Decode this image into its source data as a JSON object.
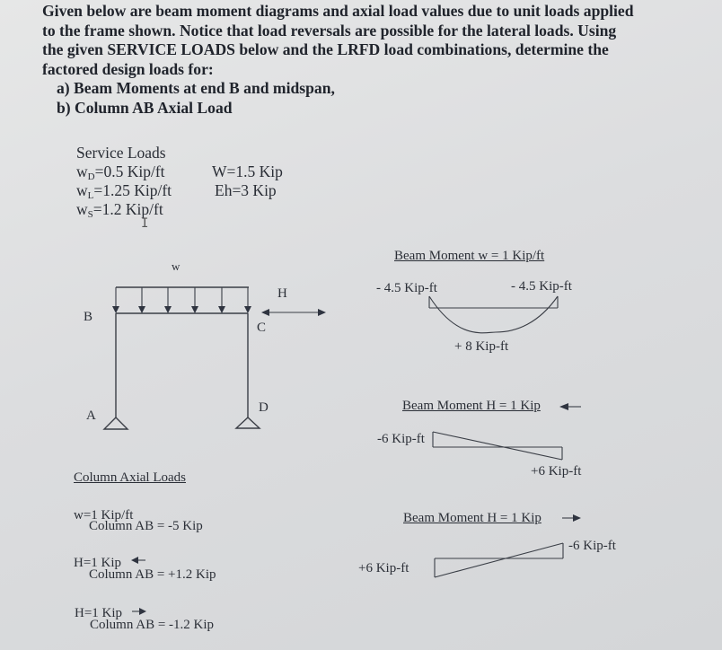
{
  "problem": {
    "intro_lines": [
      "Given below are beam moment diagrams and axial load values due to unit loads applied",
      "to the frame shown.  Notice that load reversals are possible for the lateral loads.  Using",
      "the given SERVICE LOADS below and the LRFD load combinations, determine the",
      "factored design loads for:"
    ],
    "items": [
      "a)  Beam Moments at end B and midspan,",
      "b)  Column AB Axial Load"
    ]
  },
  "service_loads": {
    "title": "Service Loads",
    "left": [
      {
        "sym": "w",
        "sub": "D",
        "value": "=0.5 Kip/ft"
      },
      {
        "sym": "w",
        "sub": "L",
        "value": "=1.25 Kip/ft"
      },
      {
        "sym": "w",
        "sub": "S",
        "value": "=1.2 Kip/ft"
      }
    ],
    "right": [
      "W=1.5 Kip",
      "Eh=3 Kip"
    ]
  },
  "frame": {
    "load_label": "w",
    "lateral_label": "H",
    "nodes": {
      "A": "A",
      "B": "B",
      "C": "C",
      "D": "D"
    }
  },
  "diagrams": {
    "gravity": {
      "title": "Beam Moment  w = 1 Kip/ft",
      "left_end": "- 4.5 Kip-ft",
      "right_end": "- 4.5 Kip-ft",
      "midspan": "+ 8 Kip-ft"
    },
    "lateral_left": {
      "title": "Beam Moment  H = 1 Kip",
      "direction": "left",
      "left_value": "-6 Kip-ft",
      "right_value": "+6 Kip-ft"
    },
    "lateral_right": {
      "title": "Beam Moment  H = 1 Kip",
      "direction": "right",
      "left_value": "+6 Kip-ft",
      "right_value": "-6 Kip-ft"
    }
  },
  "axial": {
    "title": "Column Axial Loads",
    "cases": [
      {
        "load": "w=1 Kip/ft",
        "arrow": "",
        "result": "Column AB = -5 Kip"
      },
      {
        "load": "H=1 Kip",
        "arrow": "left",
        "result": "Column AB = +1.2 Kip"
      },
      {
        "load": "H=1 Kip",
        "arrow": "right",
        "result": "Column AB = -1.2 Kip"
      }
    ]
  }
}
